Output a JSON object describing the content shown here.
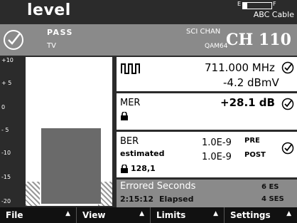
{
  "header": {
    "title": "level",
    "battery_left": "E",
    "battery_right": "F",
    "battery_level": 0.15,
    "mode": "ABC Cable"
  },
  "status": {
    "result": "PASS",
    "type": "TV",
    "chan_label": "SCI CHAN",
    "modulation": "QAM64",
    "channel": "CH 110"
  },
  "meter": {
    "scale": [
      "+10",
      "+ 5",
      "0",
      "- 5",
      "-10",
      "-15",
      "-20"
    ],
    "bar_top": -4.2,
    "bar_bottom": -20
  },
  "readings": {
    "frequency": "711.000 MHz",
    "level": "-4.2 dBmV",
    "mer_label": "MER",
    "mer_value": "+28.1 dB",
    "ber_label": "BER",
    "ber_sub": "estimated",
    "ber_pre": "1.0E-9",
    "ber_pre_label": "PRE",
    "ber_post": "1.0E-9",
    "ber_post_label": "POST",
    "ber_lock": "128,1",
    "es_label": "Errored Seconds",
    "es_count": "6 ES",
    "elapsed_time": "2:15:12",
    "elapsed_label": "Elapsed",
    "ses_count": "4 SES"
  },
  "footer": {
    "file": "File",
    "view": "View",
    "limits": "Limits",
    "settings": "Settings"
  }
}
